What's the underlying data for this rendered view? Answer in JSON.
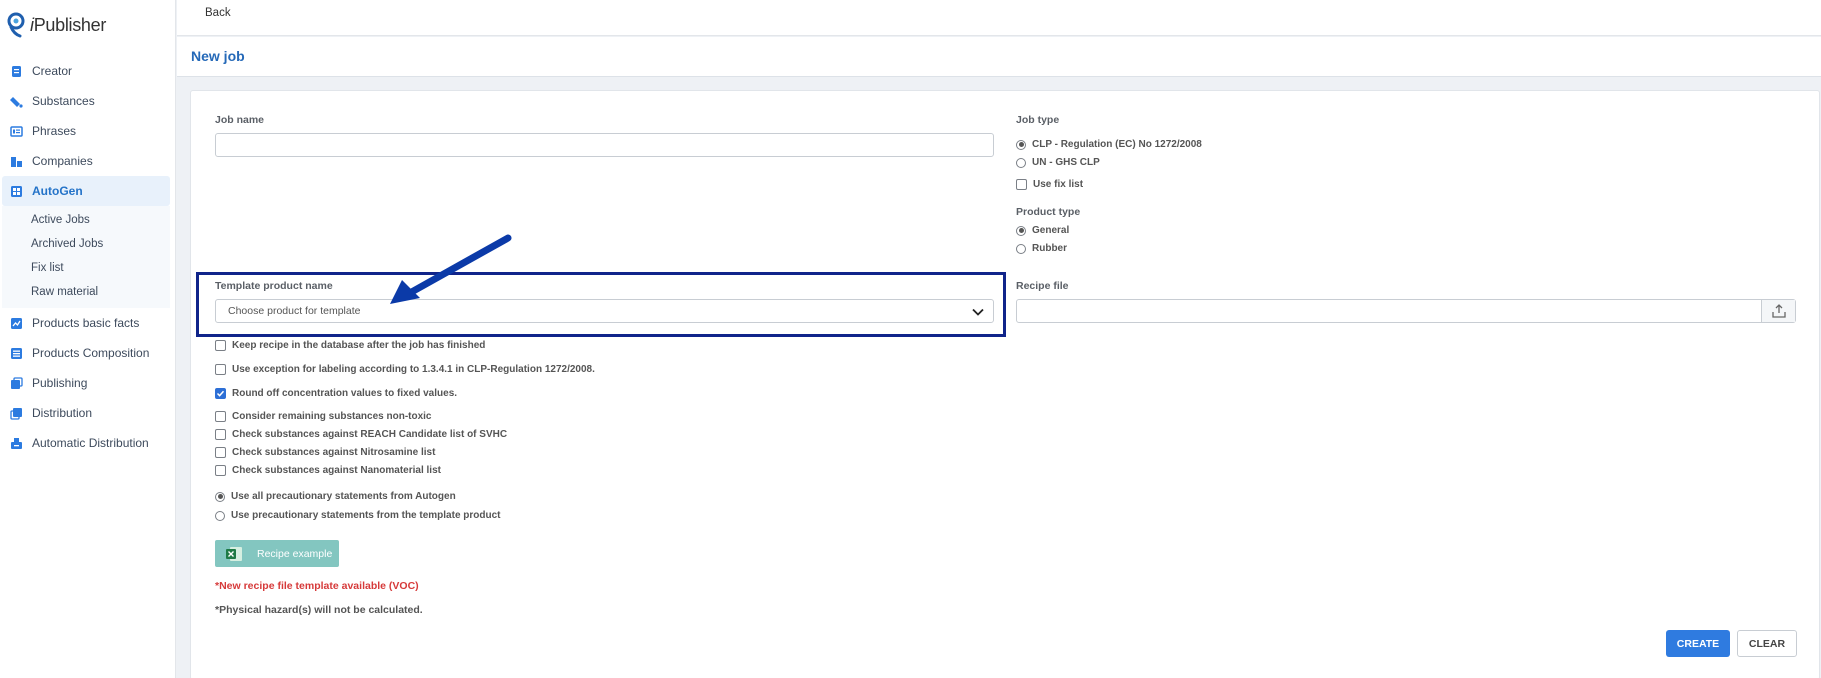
{
  "app": {
    "brand_prefix": "i",
    "brand_name": "Publisher"
  },
  "sidebar": {
    "items": [
      {
        "label": "Creator",
        "icon": "document-icon"
      },
      {
        "label": "Substances",
        "icon": "flask-icon"
      },
      {
        "label": "Phrases",
        "icon": "list-icon"
      },
      {
        "label": "Companies",
        "icon": "building-icon"
      },
      {
        "label": "AutoGen",
        "icon": "grid-icon",
        "active": true
      },
      {
        "label": "Products basic facts",
        "icon": "chart-icon"
      },
      {
        "label": "Products Composition",
        "icon": "layers-icon"
      },
      {
        "label": "Publishing",
        "icon": "publish-icon"
      },
      {
        "label": "Distribution",
        "icon": "copy-icon"
      },
      {
        "label": "Automatic Distribution",
        "icon": "tray-icon"
      }
    ],
    "autogen_sub": [
      "Active Jobs",
      "Archived Jobs",
      "Fix list",
      "Raw material"
    ]
  },
  "topbar": {
    "back_label": "Back"
  },
  "page": {
    "title": "New job"
  },
  "form": {
    "job_name_label": "Job name",
    "job_name_value": "",
    "template_label": "Template product name",
    "template_placeholder": "Choose product for template",
    "job_type_label": "Job type",
    "job_type_options": [
      "CLP - Regulation (EC) No 1272/2008",
      "UN - GHS CLP"
    ],
    "job_type_selected": "CLP - Regulation (EC) No 1272/2008",
    "use_fix_list_label": "Use fix list",
    "product_type_label": "Product type",
    "product_type_options": [
      "General",
      "Rubber"
    ],
    "product_type_selected": "General",
    "recipe_file_label": "Recipe file",
    "checks": [
      {
        "label": "Keep recipe in the database after the job has finished",
        "checked": false
      },
      {
        "label": "Use exception for labeling according to 1.3.4.1 in CLP-Regulation 1272/2008.",
        "checked": false
      },
      {
        "label": "Round off concentration values to fixed values.",
        "checked": true
      },
      {
        "label": "Consider remaining substances non-toxic",
        "checked": false
      },
      {
        "label": "Check substances against REACH Candidate list of SVHC",
        "checked": false
      },
      {
        "label": "Check substances against Nitrosamine list",
        "checked": false
      },
      {
        "label": "Check substances against Nanomaterial list",
        "checked": false
      }
    ],
    "precautionary_options": [
      "Use all precautionary statements from Autogen",
      "Use precautionary statements from the template product"
    ],
    "precautionary_selected": "Use all precautionary statements from Autogen",
    "recipe_example_label": "Recipe example",
    "note_red": "*New recipe file template available (VOC)",
    "note_physical": "*Physical hazard(s) will not be calculated.",
    "create_label": "CREATE",
    "clear_label": "CLEAR"
  },
  "colors": {
    "accent": "#2f7be0",
    "title": "#2569b8",
    "highlight": "#10248a",
    "recipe_btn": "#83c6c0",
    "note_red": "#d63a3a"
  }
}
